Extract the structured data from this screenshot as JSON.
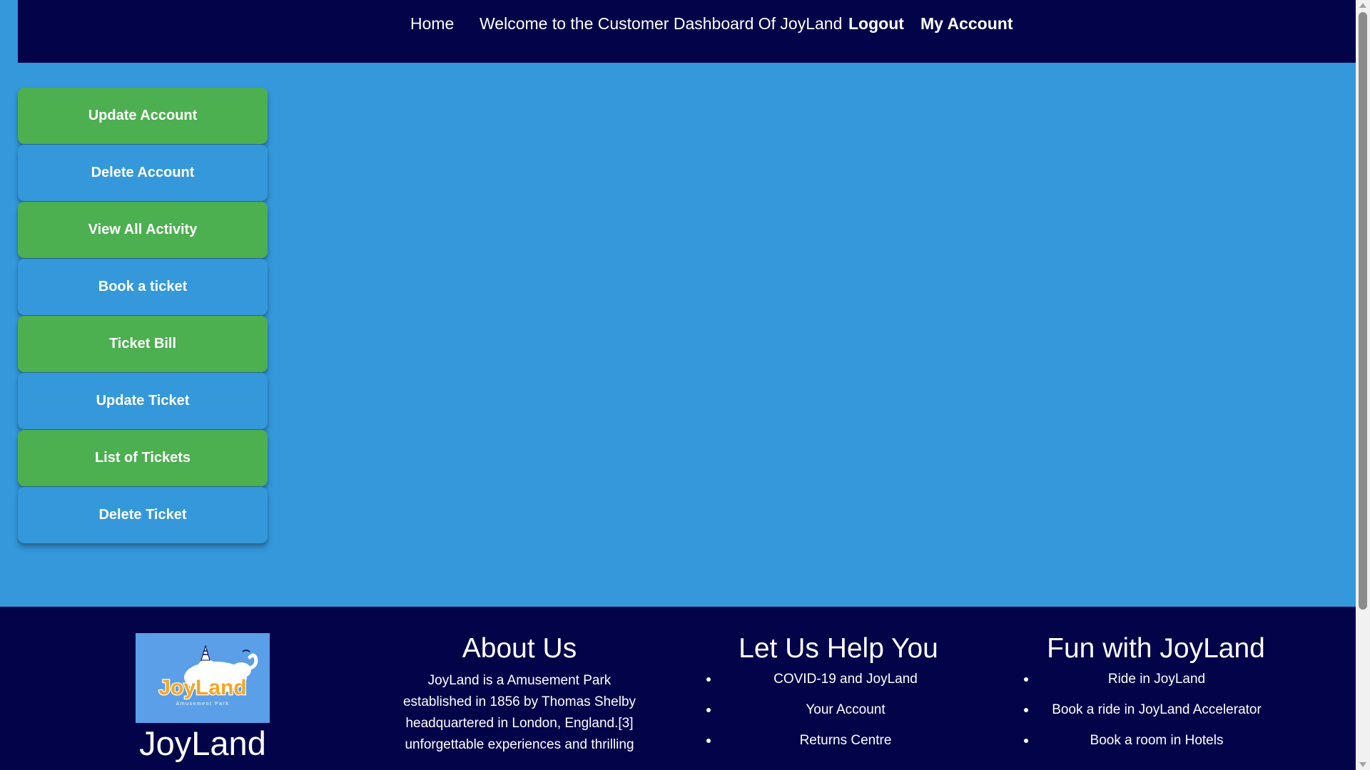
{
  "nav": {
    "home": "Home",
    "welcome": "Welcome to the Customer Dashboard Of JoyLand",
    "logout": "Logout",
    "my_account": "My Account"
  },
  "sidebar": {
    "buttons": [
      {
        "label": "Update Account",
        "color": "#4caf50"
      },
      {
        "label": "Delete Account",
        "color": "#3498db"
      },
      {
        "label": "View All Activity",
        "color": "#4caf50"
      },
      {
        "label": "Book a ticket",
        "color": "#3498db"
      },
      {
        "label": "Ticket Bill",
        "color": "#4caf50"
      },
      {
        "label": "Update Ticket",
        "color": "#3498db"
      },
      {
        "label": "List of Tickets",
        "color": "#4caf50"
      },
      {
        "label": "Delete Ticket",
        "color": "#3498db"
      }
    ]
  },
  "footer": {
    "logo_text": "JoyLand",
    "logo_subtext": "Amusement Park",
    "brand_name": "JoyLand",
    "about": {
      "title": "About Us",
      "lines": [
        "JoyLand is a Amusement Park",
        "established in 1856 by Thomas Shelby",
        "headquartered in London, England.[3]",
        "unforgettable experiences and thrilling"
      ]
    },
    "help": {
      "title": "Let Us Help You",
      "items": [
        "COVID-19 and JoyLand",
        "Your Account",
        "Returns Centre"
      ]
    },
    "fun": {
      "title": "Fun with JoyLand",
      "items": [
        "Ride in JoyLand",
        "Book a ride in JoyLand Accelerator",
        "Book a room in Hotels"
      ]
    }
  },
  "colors": {
    "navy": "#03034a",
    "page_blue": "#3498db",
    "green": "#4caf50",
    "logo_bg": "#5a9fe8",
    "logo_orange": "#f5a623"
  }
}
